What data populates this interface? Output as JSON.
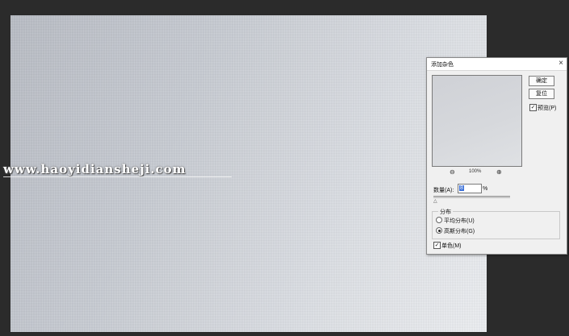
{
  "watermark": {
    "text": "www.haoyidiansheji.com"
  },
  "dialog": {
    "title": "添加杂色",
    "close_icon": "×",
    "ok_label": "确定",
    "reset_label": "复位",
    "preview_check": "✓",
    "preview_label": "预览(P)",
    "zoom_out_icon": "⊖",
    "zoom_value": "100%",
    "zoom_in_icon": "⊕",
    "amount_label": "数量(A):",
    "amount_value": "8",
    "amount_unit": "%",
    "slider_marker": "△",
    "distribution_label": "分布",
    "uniform_label": "平均分布(U)",
    "gaussian_label": "高斯分布(G)",
    "selected_distribution": "gaussian",
    "mono_check": "✓",
    "mono_label": "单色(M)"
  }
}
